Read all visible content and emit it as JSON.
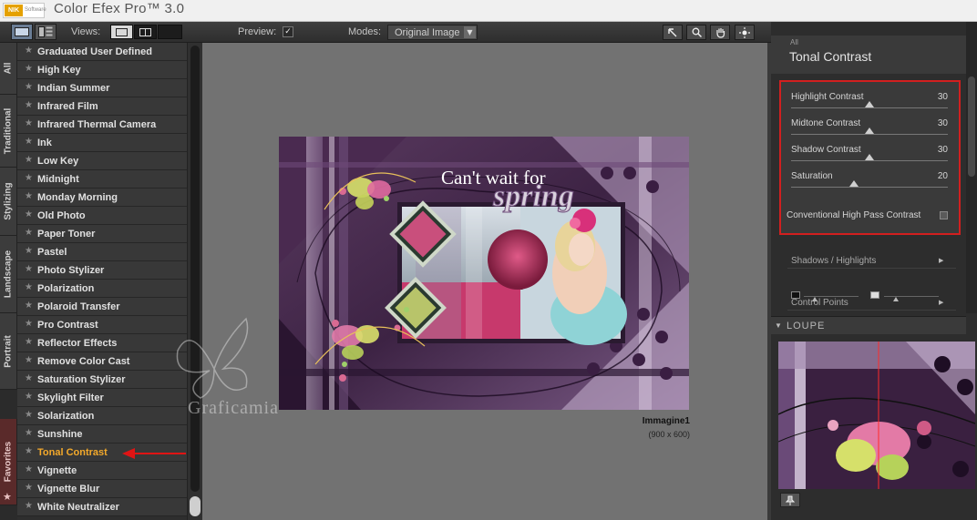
{
  "app": {
    "title": "Color Efex Pro™ 3.0",
    "logo_text": "NIK",
    "logo_sub": "Software"
  },
  "toolbar": {
    "views_label": "Views:",
    "preview_label": "Preview:",
    "preview_checked": "✓",
    "modes_label": "Modes:",
    "modes_value": "Original Image"
  },
  "categories": [
    {
      "label": "All"
    },
    {
      "label": "Traditional"
    },
    {
      "label": "Stylizing"
    },
    {
      "label": "Landscape"
    },
    {
      "label": "Portrait"
    },
    {
      "label": "Favorites"
    }
  ],
  "filters": [
    "Graduated User Defined",
    "High Key",
    "Indian Summer",
    "Infrared Film",
    "Infrared Thermal Camera",
    "Ink",
    "Low Key",
    "Midnight",
    "Monday Morning",
    "Old Photo",
    "Paper Toner",
    "Pastel",
    "Photo Stylizer",
    "Polarization",
    "Polaroid Transfer",
    "Pro Contrast",
    "Reflector Effects",
    "Remove Color Cast",
    "Saturation Stylizer",
    "Skylight Filter",
    "Solarization",
    "Sunshine",
    "Tonal Contrast",
    "Vignette",
    "Vignette Blur",
    "White Neutralizer"
  ],
  "active_filter_index": 22,
  "image": {
    "title_line1": "Can't wait for",
    "title_line2": "spring",
    "caption": "Immagine1",
    "size": "(900 x 600)",
    "watermark": "Graficamia"
  },
  "panel": {
    "breadcrumb": "All",
    "filter_name": "Tonal Contrast",
    "sliders": [
      {
        "label": "Highlight Contrast",
        "value": "30",
        "level": 0.5
      },
      {
        "label": "Midtone Contrast",
        "value": "30",
        "level": 0.5
      },
      {
        "label": "Shadow Contrast",
        "value": "30",
        "level": 0.5
      },
      {
        "label": "Saturation",
        "value": "20",
        "level": 0.4
      }
    ],
    "conventional_label": "Conventional High Pass Contrast",
    "sections": {
      "shadows_highlights": "Shadows / Highlights",
      "control_points": "Control Points",
      "loupe": "LOUPE"
    }
  },
  "colors": {
    "active_filter": "#f3a92b",
    "highlight_box": "#d21f1f",
    "arrow": "#e01414"
  }
}
